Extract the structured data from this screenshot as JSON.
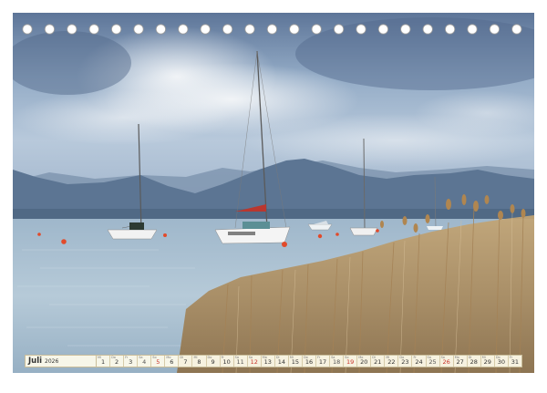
{
  "calendar": {
    "month": "Juli",
    "year": "2026",
    "days": [
      {
        "n": "1",
        "wd": "Mi",
        "type": "weekday"
      },
      {
        "n": "2",
        "wd": "Do",
        "type": "weekday"
      },
      {
        "n": "3",
        "wd": "Fr",
        "type": "weekday"
      },
      {
        "n": "4",
        "wd": "Sa",
        "type": "sat"
      },
      {
        "n": "5",
        "wd": "So",
        "type": "sun"
      },
      {
        "n": "6",
        "wd": "Mo",
        "type": "weekday"
      },
      {
        "n": "7",
        "wd": "Di",
        "type": "weekday"
      },
      {
        "n": "8",
        "wd": "Mi",
        "type": "weekday"
      },
      {
        "n": "9",
        "wd": "Do",
        "type": "weekday"
      },
      {
        "n": "10",
        "wd": "Fr",
        "type": "weekday"
      },
      {
        "n": "11",
        "wd": "Sa",
        "type": "sat"
      },
      {
        "n": "12",
        "wd": "So",
        "type": "sun"
      },
      {
        "n": "13",
        "wd": "Mo",
        "type": "weekday"
      },
      {
        "n": "14",
        "wd": "Di",
        "type": "weekday"
      },
      {
        "n": "15",
        "wd": "Mi",
        "type": "weekday"
      },
      {
        "n": "16",
        "wd": "Do",
        "type": "weekday"
      },
      {
        "n": "17",
        "wd": "Fr",
        "type": "weekday"
      },
      {
        "n": "18",
        "wd": "Sa",
        "type": "sat"
      },
      {
        "n": "19",
        "wd": "So",
        "type": "sun"
      },
      {
        "n": "20",
        "wd": "Mo",
        "type": "weekday"
      },
      {
        "n": "21",
        "wd": "Di",
        "type": "weekday"
      },
      {
        "n": "22",
        "wd": "Mi",
        "type": "weekday"
      },
      {
        "n": "23",
        "wd": "Do",
        "type": "weekday"
      },
      {
        "n": "24",
        "wd": "Fr",
        "type": "weekday"
      },
      {
        "n": "25",
        "wd": "Sa",
        "type": "sat"
      },
      {
        "n": "26",
        "wd": "So",
        "type": "sun"
      },
      {
        "n": "27",
        "wd": "Mo",
        "type": "weekday"
      },
      {
        "n": "28",
        "wd": "Di",
        "type": "weekday"
      },
      {
        "n": "29",
        "wd": "Mi",
        "type": "weekday"
      },
      {
        "n": "30",
        "wd": "Do",
        "type": "weekday"
      },
      {
        "n": "31",
        "wd": "Fr",
        "type": "weekday"
      }
    ]
  },
  "colors": {
    "sky_top": "#6f86a6",
    "sky_mid": "#a9bdd3",
    "mountain": "#5f7795",
    "lake": "#a8c1d2",
    "reeds": "#b99a66",
    "sunday": "#c8342c"
  }
}
